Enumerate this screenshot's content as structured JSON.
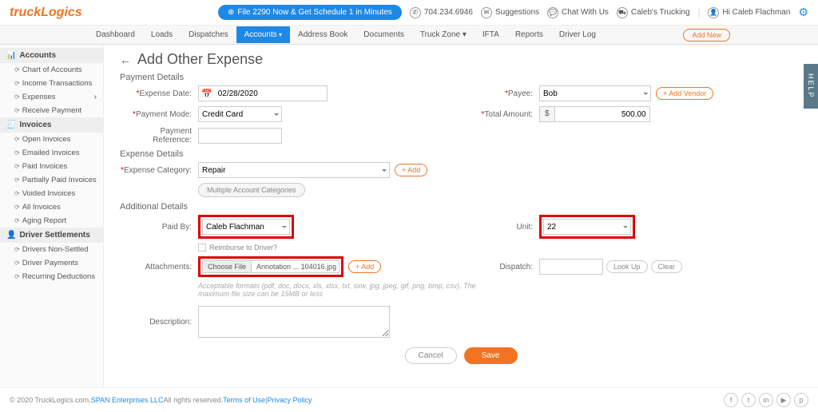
{
  "top": {
    "logo1": "truck",
    "logo2": "Logics",
    "promo": "File 2290 Now & Get Schedule 1 in Minutes",
    "phone": "704.234.6946",
    "suggestions": "Suggestions",
    "chat": "Chat With Us",
    "company": "Caleb's Trucking",
    "greeting": "Hi Caleb Flachman"
  },
  "nav": {
    "dashboard": "Dashboard",
    "loads": "Loads",
    "dispatches": "Dispatches",
    "accounts": "Accounts",
    "addressbook": "Address Book",
    "documents": "Documents",
    "truckzone": "Truck Zone",
    "ifta": "IFTA",
    "reports": "Reports",
    "driverlog": "Driver Log",
    "addnew": "Add New"
  },
  "sidebar": {
    "accounts": "Accounts",
    "coa": "Chart of Accounts",
    "income": "Income Transactions",
    "expenses": "Expenses",
    "receive": "Receive Payment",
    "invoices": "Invoices",
    "open": "Open Invoices",
    "emailed": "Emailed Invoices",
    "paid": "Paid Invoices",
    "partial": "Partially Paid Invoices",
    "voided": "Voided Invoices",
    "all": "All Invoices",
    "aging": "Aging Report",
    "driver": "Driver Settlements",
    "notsettled": "Drivers Non-Settled",
    "payments": "Driver Payments",
    "recurring": "Recurring Deductions"
  },
  "page": {
    "title": "Add Other Expense",
    "payment_details": "Payment Details",
    "expense_date": "Expense Date:",
    "expense_date_val": "02/28/2020",
    "payment_mode": "Payment Mode:",
    "payment_mode_val": "Credit Card",
    "payment_ref": "Payment Reference:",
    "payee": "Payee:",
    "payee_val": "Bob",
    "add_vendor": "+ Add Vendor",
    "total_amount": "Total Amount:",
    "currency": "$",
    "amount_val": "500.00",
    "expense_details": "Expense Details",
    "expense_category": "Expense Category:",
    "expense_category_val": "Repair",
    "add": "+ Add",
    "multiple": "Multiple Account Categories",
    "additional": "Additional Details",
    "paid_by": "Paid By:",
    "paid_by_val": "Caleb Flachman",
    "reimburse": "Reimburse to Driver?",
    "unit": "Unit:",
    "unit_val": "22",
    "attachments": "Attachments:",
    "choose_file": "Choose File",
    "file_name": "Annotation ... 104016.jpg",
    "dispatch": "Dispatch:",
    "lookup": "Look Up",
    "clear": "Clear",
    "hint": "Acceptable formats (pdf, doc, docx, xls, xlsx, txt, sxw, jpg, jpeg, gif, png, bmp, csv). The maximum file size can be 15MB or less",
    "description": "Description:",
    "cancel": "Cancel",
    "save": "Save"
  },
  "footer": {
    "copyright": "© 2020 TruckLogics.com, ",
    "span": "SPAN Enterprises LLC",
    "rights": " All rights reserved. ",
    "terms": "Terms of Use",
    "sep": " | ",
    "privacy": "Privacy Policy"
  },
  "help": "HELP"
}
